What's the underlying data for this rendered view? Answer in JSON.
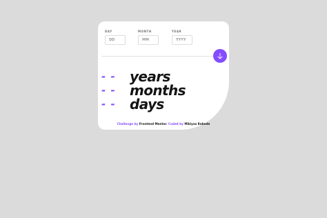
{
  "form": {
    "day": {
      "label": "DAY",
      "placeholder": "DD"
    },
    "month": {
      "label": "MONTH",
      "placeholder": "MM"
    },
    "year": {
      "label": "YEAR",
      "placeholder": "YYYY"
    }
  },
  "submit": {
    "icon": "arrow-down-icon"
  },
  "results": {
    "years": {
      "value": "- -",
      "unit": "years"
    },
    "months": {
      "value": "- -",
      "unit": "months"
    },
    "days": {
      "value": "- -",
      "unit": "days"
    }
  },
  "attribution": {
    "challenge": "Challenge by",
    "frontend_mentor": "Frontend Mentor",
    "coded": ". Coded by",
    "author": "Mikiyas Kebede"
  },
  "colors": {
    "accent": "#854dff",
    "background": "#dbdbdb",
    "card": "#ffffff",
    "text": "#141414"
  }
}
